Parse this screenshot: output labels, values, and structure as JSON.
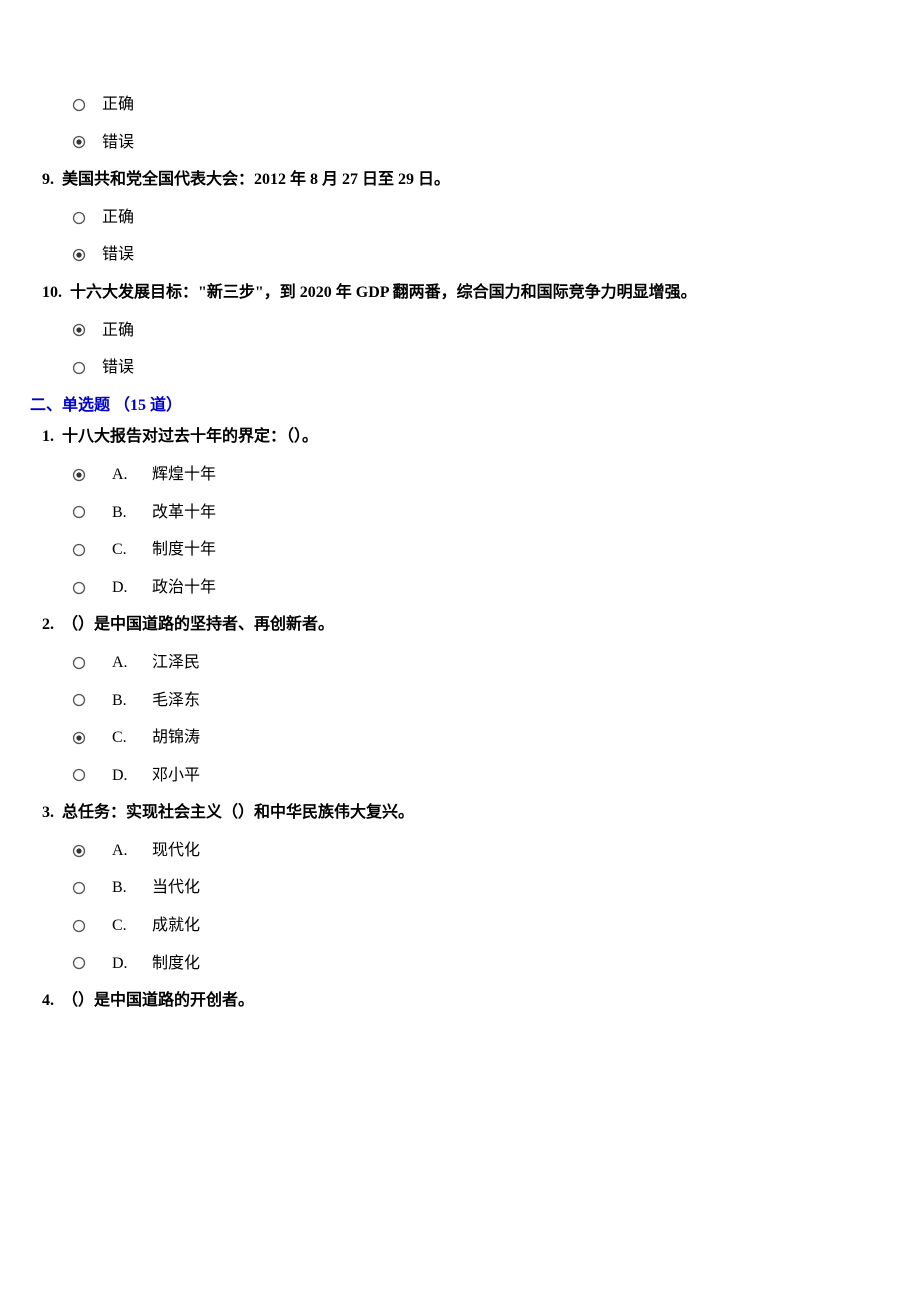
{
  "tf_prev": {
    "opt_true": "正确",
    "opt_false": "错误"
  },
  "q9": {
    "num": "9.",
    "text": "美国共和党全国代表大会：2012 年 8 月 27 日至 29 日。",
    "opt_true": "正确",
    "opt_false": "错误"
  },
  "q10": {
    "num": "10.",
    "text": "十六大发展目标：\"新三步\"，到 2020 年 GDP 翻两番，综合国力和国际竞争力明显增强。",
    "opt_true": "正确",
    "opt_false": "错误"
  },
  "section2": {
    "title": "二、单选题 （15 道）"
  },
  "mc1": {
    "num": "1.",
    "text": "十八大报告对过去十年的界定：（）。",
    "A": {
      "letter": "A.",
      "text": "辉煌十年"
    },
    "B": {
      "letter": "B.",
      "text": "改革十年"
    },
    "C": {
      "letter": "C.",
      "text": "制度十年"
    },
    "D": {
      "letter": "D.",
      "text": "政治十年"
    }
  },
  "mc2": {
    "num": "2.",
    "text": "（）是中国道路的坚持者、再创新者。",
    "A": {
      "letter": "A.",
      "text": "江泽民"
    },
    "B": {
      "letter": "B.",
      "text": "毛泽东"
    },
    "C": {
      "letter": "C.",
      "text": "胡锦涛"
    },
    "D": {
      "letter": "D.",
      "text": "邓小平"
    }
  },
  "mc3": {
    "num": "3.",
    "text": "总任务：实现社会主义（）和中华民族伟大复兴。",
    "A": {
      "letter": "A.",
      "text": "现代化"
    },
    "B": {
      "letter": "B.",
      "text": "当代化"
    },
    "C": {
      "letter": "C.",
      "text": "成就化"
    },
    "D": {
      "letter": "D.",
      "text": "制度化"
    }
  },
  "mc4": {
    "num": "4.",
    "text": "（）是中国道路的开创者。"
  }
}
